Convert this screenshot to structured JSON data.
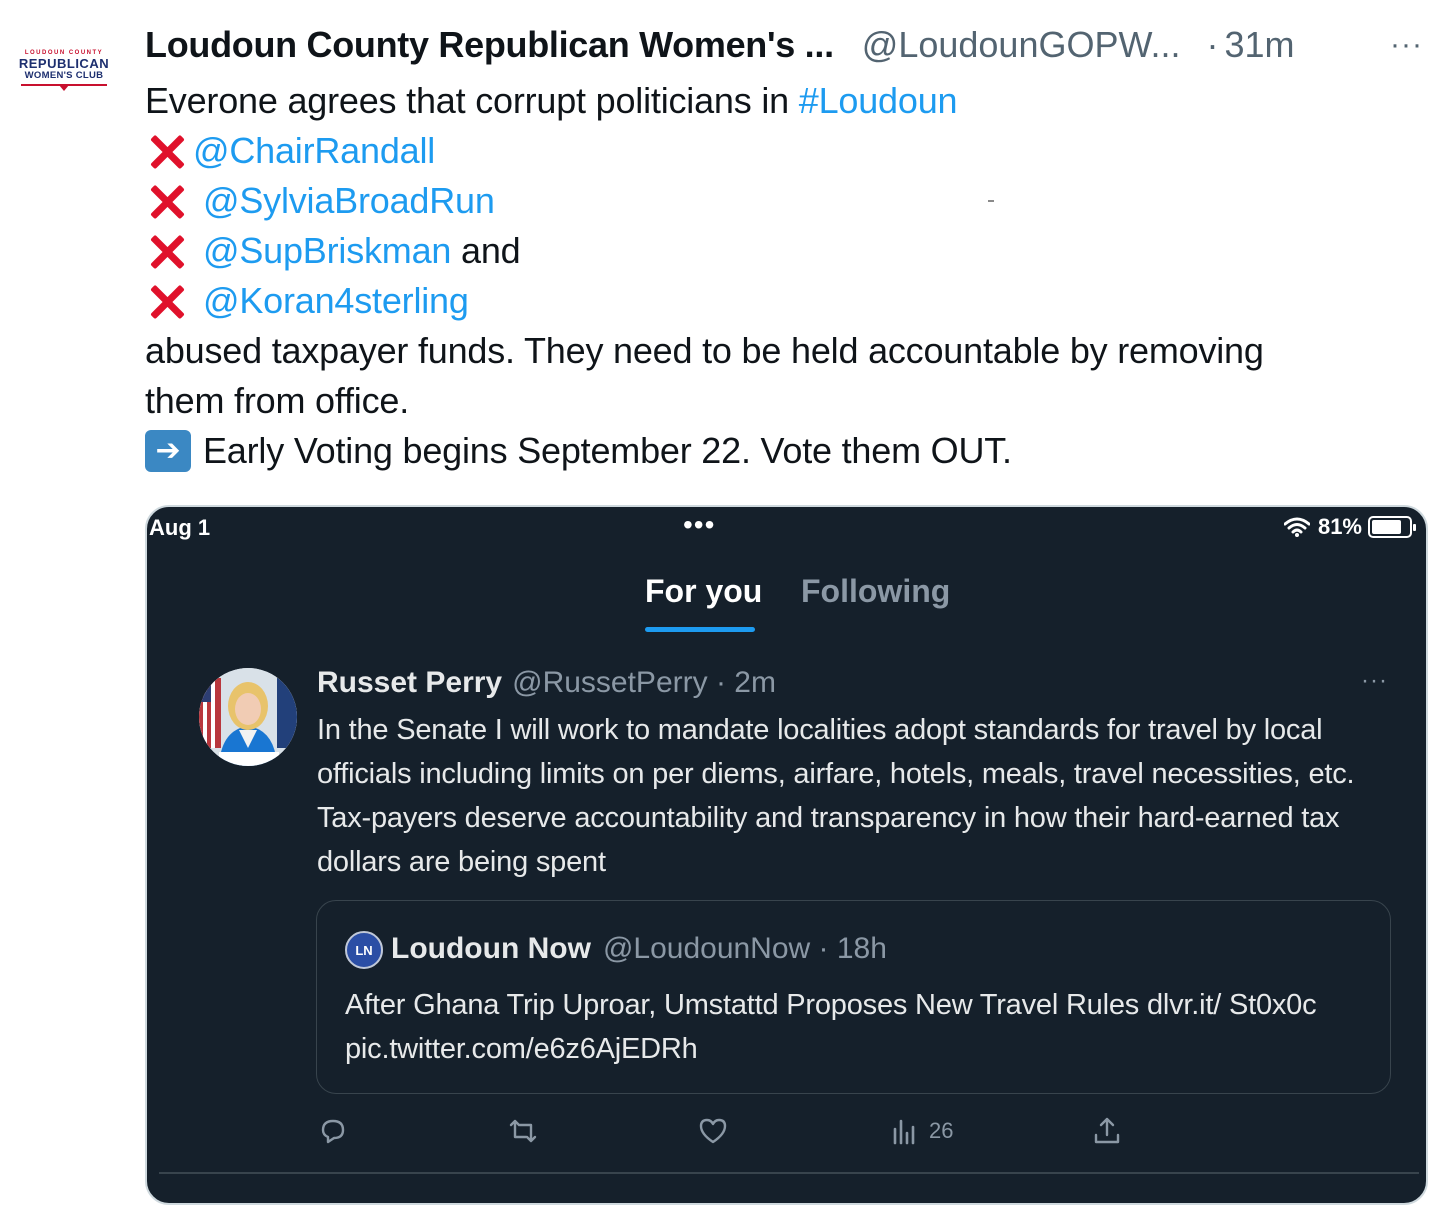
{
  "outer_tweet": {
    "avatar": {
      "logo_top": "LOUDOUN COUNTY",
      "logo_mid": "REPUBLICAN",
      "logo_bot": "WOMEN'S CLUB"
    },
    "display_name": "Loudoun County Republican Women's ...",
    "handle": "@LoudounGOPW...",
    "separator": "·",
    "time": "31m",
    "more_icon": "···",
    "lines": {
      "l1_text": "Everone agrees that corrupt politicians in ",
      "l1_hashtag": "#Loudoun",
      "mention_1": "@ChairRandall",
      "mention_2": "@SylviaBroadRun",
      "mention_3": "@SupBriskman",
      "mention_3_after": " and",
      "mention_4": "@Koran4sterling",
      "l6": "abused taxpayer funds. They need to be held accountable by removing",
      "l7": "them from office.",
      "l8": "Early Voting begins September 22. Vote them OUT."
    },
    "icons": {
      "x_mark": "cross-mark-emoji",
      "arrow": "right-arrow-emoji"
    },
    "accent_color": "#1d9bf0",
    "x_color": "#e0112b"
  },
  "embedded": {
    "status_bar": {
      "date": "Aug 1",
      "dots": "•••",
      "battery": "81%"
    },
    "tabs": [
      {
        "label": "For you",
        "active": true
      },
      {
        "label": "Following",
        "active": false
      }
    ],
    "tweet": {
      "name": "Russet Perry",
      "handle": "@RussetPerry · 2m",
      "more_icon": "···",
      "text": "In the Senate I will work to mandate localities adopt standards for travel by local officials including limits on per diems, airfare, hotels, meals, travel necessities, etc. Tax-payers deserve accountability and transparency in how their hard-earned tax dollars are being spent"
    },
    "quote": {
      "avatar_text": "LN",
      "name": "Loudoun Now",
      "handle": "@LoudounNow · 18h",
      "text": "After Ghana Trip Uproar, Umstattd Proposes New Travel Rules dlvr.it/ St0x0c pic.twitter.com/e6z6AjEDRh"
    },
    "actions": {
      "views": "26"
    },
    "background_color": "#15202b"
  }
}
